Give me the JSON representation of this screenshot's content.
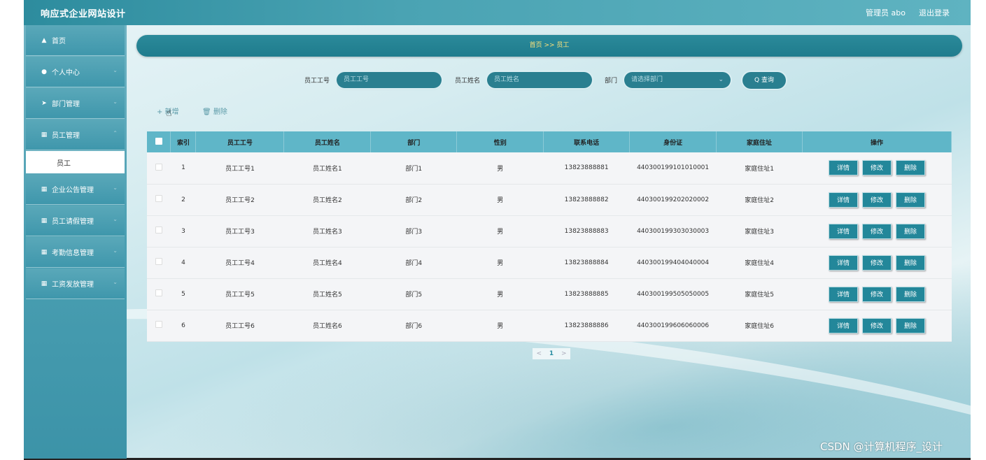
{
  "header": {
    "app_title": "响应式企业网站设计",
    "admin_label": "管理员 abo",
    "logout_label": "退出登录"
  },
  "sidebar": {
    "items": [
      {
        "label": "首页",
        "icon": "home-icon"
      },
      {
        "label": "个人中心",
        "icon": "user-icon"
      },
      {
        "label": "部门管理",
        "icon": "send-icon"
      },
      {
        "label": "员工管理",
        "icon": "grid-icon"
      },
      {
        "label": "企业公告管理",
        "icon": "grid-icon"
      },
      {
        "label": "员工请假管理",
        "icon": "grid-icon"
      },
      {
        "label": "考勤信息管理",
        "icon": "grid-icon"
      },
      {
        "label": "工资发放管理",
        "icon": "grid-icon"
      }
    ],
    "sub_item": "员工"
  },
  "breadcrumb": "首页 >> 员工",
  "search": {
    "id_label": "员工工号",
    "id_placeholder": "员工工号",
    "name_label": "员工姓名",
    "name_placeholder": "员工姓名",
    "dept_label": "部门",
    "dept_placeholder": "请选择部门",
    "query_label": "Q 查询"
  },
  "actions": {
    "add": "+ 新增",
    "delete": "删除"
  },
  "table": {
    "headers": [
      "索引",
      "员工工号",
      "员工姓名",
      "部门",
      "性别",
      "联系电话",
      "身份证",
      "家庭住址",
      "操作"
    ],
    "rows": [
      [
        "1",
        "员工工号1",
        "员工姓名1",
        "部门1",
        "男",
        "13823888881",
        "440300199101010001",
        "家庭住址1"
      ],
      [
        "2",
        "员工工号2",
        "员工姓名2",
        "部门2",
        "男",
        "13823888882",
        "440300199202020002",
        "家庭住址2"
      ],
      [
        "3",
        "员工工号3",
        "员工姓名3",
        "部门3",
        "男",
        "13823888883",
        "440300199303030003",
        "家庭住址3"
      ],
      [
        "4",
        "员工工号4",
        "员工姓名4",
        "部门4",
        "男",
        "13823888884",
        "440300199404040004",
        "家庭住址4"
      ],
      [
        "5",
        "员工工号5",
        "员工姓名5",
        "部门5",
        "男",
        "13823888885",
        "440300199505050005",
        "家庭住址5"
      ],
      [
        "6",
        "员工工号6",
        "员工姓名6",
        "部门6",
        "男",
        "13823888886",
        "440300199606060006",
        "家庭住址6"
      ]
    ],
    "row_buttons": [
      "详情",
      "修改",
      "删除"
    ]
  },
  "pagination": {
    "prev": "<",
    "current": "1",
    "next": ">"
  },
  "watermark": "CSDN @计算机程序_设计"
}
